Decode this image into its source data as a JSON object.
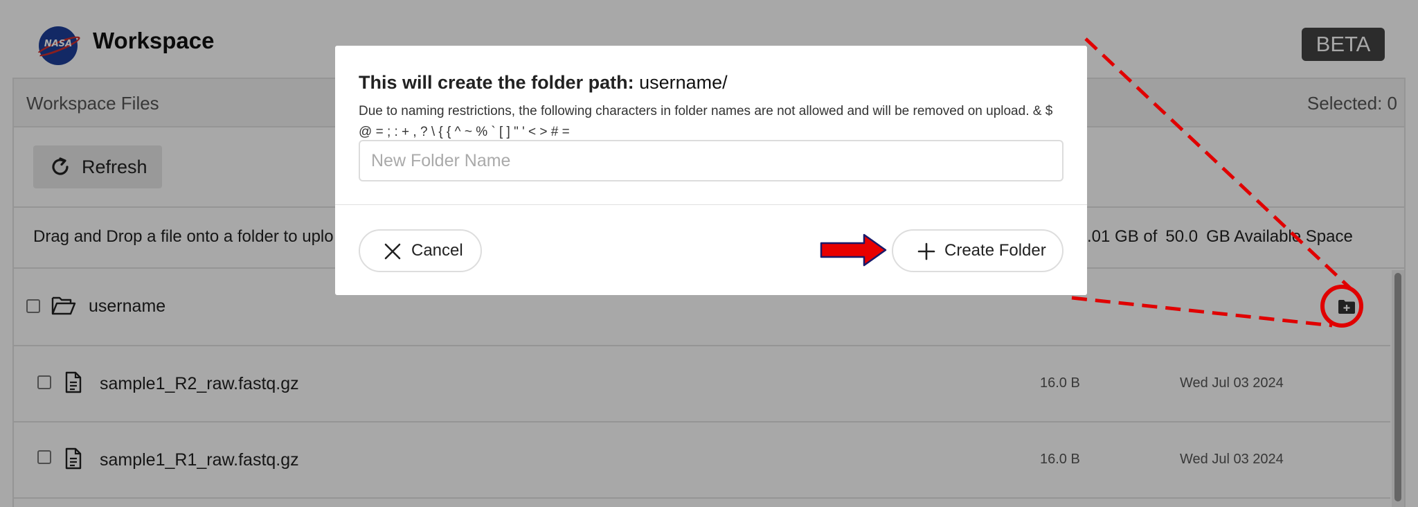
{
  "app": {
    "title": "Workspace",
    "logo_text": "NASA",
    "badge": "BETA"
  },
  "panel": {
    "title": "Workspace Files",
    "selected_label": "Selected: 0",
    "refresh_label": "Refresh",
    "drag_text": "Drag and Drop a file onto a folder to uplo",
    "space_used": ".01 GB of",
    "space_total": "50.0",
    "space_suffix": "GB Available Space"
  },
  "rows": [
    {
      "type": "folder",
      "name": "username",
      "size": "",
      "date": ""
    },
    {
      "type": "file",
      "name": "sample1_R2_raw.fastq.gz",
      "size": "16.0 B",
      "date": "Wed Jul 03 2024"
    },
    {
      "type": "file",
      "name": "sample1_R1_raw.fastq.gz",
      "size": "16.0 B",
      "date": "Wed Jul 03 2024"
    }
  ],
  "modal": {
    "title_prefix": "This will create the folder path:",
    "title_path": "username/",
    "description": "Due to naming restrictions, the following characters in folder names are not allowed and will be removed on upload. & $ @ = ; : + , ? \\ { { ^ ~ % ` [ ] \" ' < > # =",
    "input_placeholder": "New Folder Name",
    "input_value": "",
    "cancel_label": "Cancel",
    "create_label": "Create Folder"
  },
  "colors": {
    "overlay": "#000000",
    "annotation": "#e00000",
    "badge_bg": "#444444",
    "logo_blue": "#1d3f9a"
  },
  "icons": {
    "refresh": "refresh-icon",
    "folder": "folder-open-icon",
    "file": "file-text-icon",
    "add_folder": "folder-plus-icon",
    "cancel": "close-icon",
    "create": "plus-icon",
    "annotation_arrow": "red-arrow-icon"
  }
}
